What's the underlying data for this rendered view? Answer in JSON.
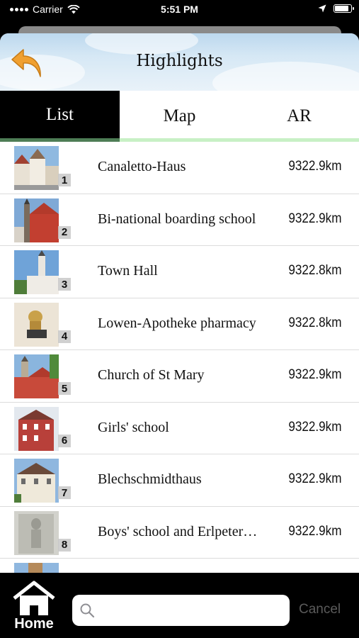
{
  "status_bar": {
    "carrier": "Carrier",
    "time": "5:51 PM",
    "icons": [
      "wifi-icon",
      "location-arrow-icon",
      "battery-icon"
    ]
  },
  "header": {
    "title": "Highlights",
    "back_icon": "back-arrow-icon",
    "back_color": "#f0a030"
  },
  "tabs": [
    {
      "label": "List",
      "active": true
    },
    {
      "label": "Map",
      "active": false
    },
    {
      "label": "AR",
      "active": false
    }
  ],
  "colors": {
    "tab_active_bg": "#000000",
    "tab_active_underline": "#4e7d55",
    "tab_inactive_underline": "#c8f0c5"
  },
  "list": {
    "items": [
      {
        "number": "1",
        "title": "Canaletto-Haus",
        "distance": "9322.9km"
      },
      {
        "number": "2",
        "title": "Bi-national boarding school",
        "distance": "9322.9km"
      },
      {
        "number": "3",
        "title": "Town Hall",
        "distance": "9322.8km"
      },
      {
        "number": "4",
        "title": "Lowen-Apotheke pharmacy",
        "distance": "9322.8km"
      },
      {
        "number": "5",
        "title": "Church of St Mary",
        "distance": "9322.9km"
      },
      {
        "number": "6",
        "title": "Girls' school",
        "distance": "9322.9km"
      },
      {
        "number": "7",
        "title": "Blechschmidthaus",
        "distance": "9322.9km"
      },
      {
        "number": "8",
        "title": "Boys' school and Erlpeter…",
        "distance": "9322.9km"
      }
    ]
  },
  "bottom_bar": {
    "home_label": "Home",
    "search_placeholder": "",
    "cancel_label": "Cancel"
  }
}
